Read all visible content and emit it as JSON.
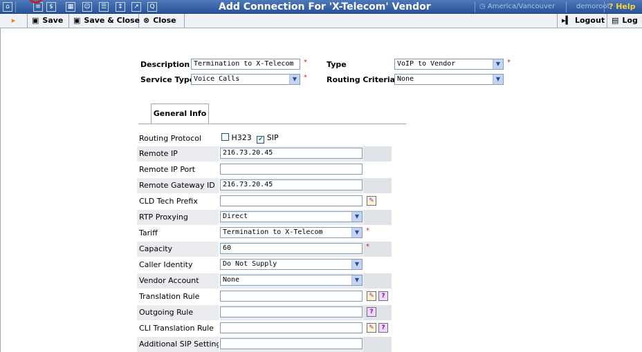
{
  "header": {
    "title": "Add Connection For 'X-Telecom' Vendor",
    "timezone": "America/Vancouver",
    "user": "demoroot",
    "help": "Help",
    "icons": [
      "home-icon",
      "menu-icon",
      "dollar-icon",
      "grid-icon",
      "person-icon",
      "list-icon",
      "tree-icon",
      "chart-icon",
      "search-icon"
    ]
  },
  "toolbar": {
    "save": "Save",
    "save_close": "Save & Close",
    "close": "Close",
    "logout": "Logout",
    "log": "Log"
  },
  "form": {
    "description_label": "Description",
    "description_value": "Termination to X-Telecom",
    "type_label": "Type",
    "type_value": "VoIP to Vendor",
    "service_type_label": "Service Type",
    "service_type_value": "Voice Calls",
    "routing_criteria_label": "Routing Criteria",
    "routing_criteria_value": "None"
  },
  "tabs": {
    "general": "General Info"
  },
  "general": {
    "routing_protocol": {
      "label": "Routing Protocol",
      "h323": "H323",
      "sip": "SIP"
    },
    "remote_ip": {
      "label": "Remote IP",
      "value": "216.73.20.45"
    },
    "remote_ip_port": {
      "label": "Remote IP Port",
      "value": ""
    },
    "remote_gateway_id": {
      "label": "Remote Gateway ID",
      "value": "216.73.20.45"
    },
    "cld_tech_prefix": {
      "label": "CLD Tech Prefix",
      "value": ""
    },
    "rtp_proxying": {
      "label": "RTP Proxying",
      "value": "Direct"
    },
    "tariff": {
      "label": "Tariff",
      "value": "Termination to X-Telecom"
    },
    "capacity": {
      "label": "Capacity",
      "value": "60"
    },
    "caller_identity": {
      "label": "Caller Identity",
      "value": "Do Not Supply"
    },
    "vendor_account": {
      "label": "Vendor Account",
      "value": "None"
    },
    "translation_rule": {
      "label": "Translation Rule",
      "value": ""
    },
    "outgoing_rule": {
      "label": "Outgoing Rule",
      "value": ""
    },
    "cli_translation_rule": {
      "label": "CLI Translation Rule",
      "value": ""
    },
    "additional_sip": {
      "label": "Additional SIP Settings",
      "value": ""
    }
  }
}
